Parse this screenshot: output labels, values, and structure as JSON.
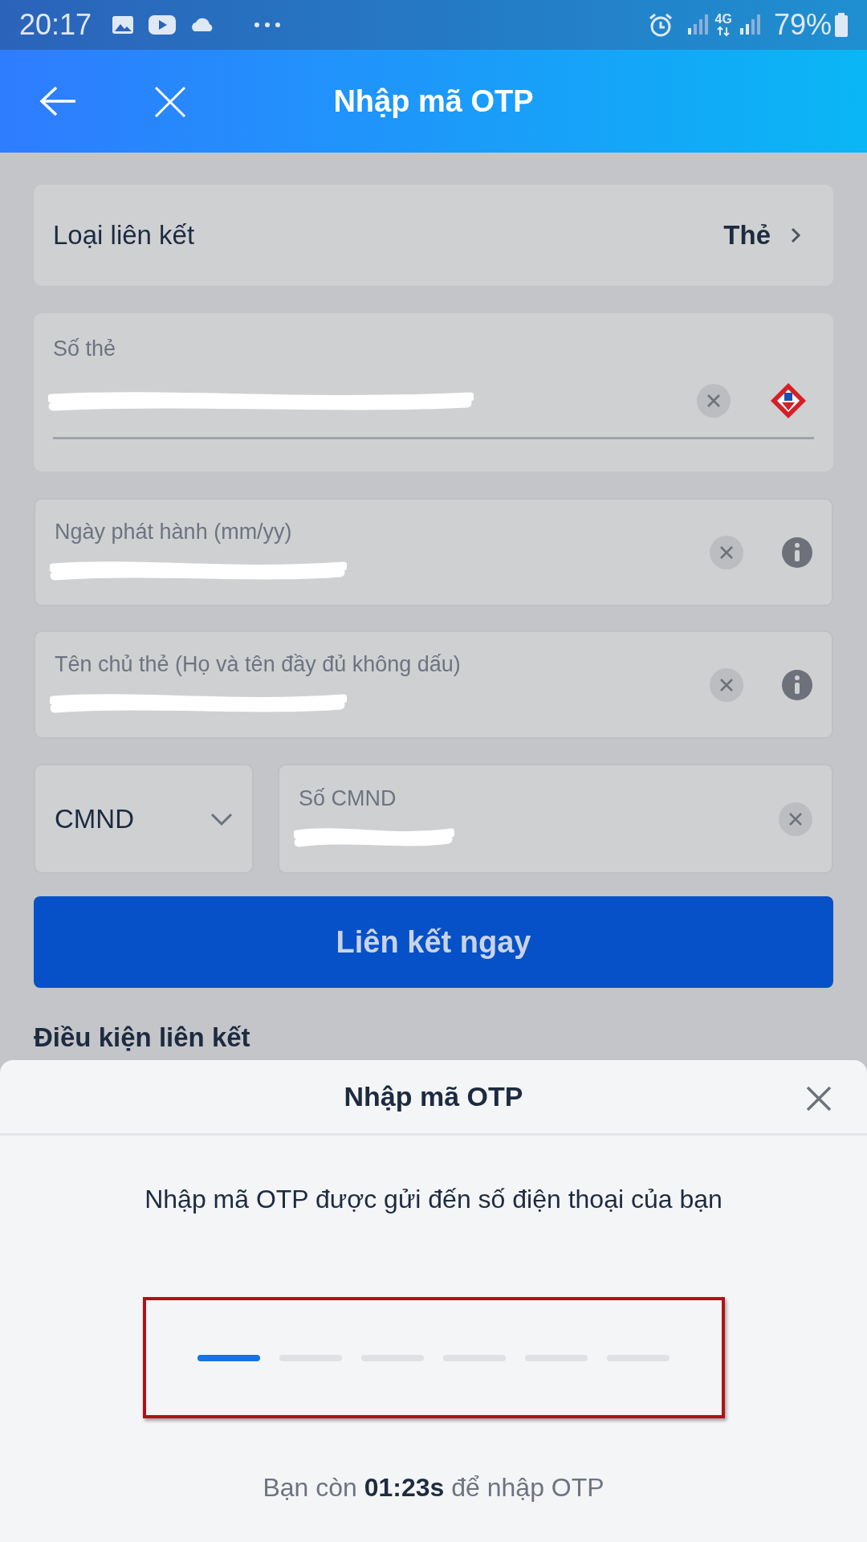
{
  "status_bar": {
    "time": "20:17",
    "network": "4G",
    "battery": "79%"
  },
  "header": {
    "title": "Nhập mã OTP"
  },
  "link_type": {
    "label": "Loại liên kết",
    "value": "Thẻ"
  },
  "fields": [
    {
      "kind": "card",
      "label": "Số thẻ",
      "redacted": true
    },
    {
      "kind": "info",
      "label": "Ngày phát hành (mm/yy)",
      "redacted": true
    },
    {
      "kind": "info",
      "label": "Tên chủ thẻ (Họ và tên đầy đủ không dấu)",
      "redacted": true
    }
  ],
  "id_row": {
    "type": "CMND",
    "field": {
      "label": "Số CMND",
      "redacted": true
    }
  },
  "submit": "Liên kết ngay",
  "section_title": "Điều kiện liên kết",
  "otp_sheet": {
    "title": "Nhập mã OTP",
    "instruction": "Nhập mã OTP được gửi đến số điện thoại của bạn",
    "highlighted": true,
    "slots": [
      {
        "selected": true
      },
      {
        "selected": false
      },
      {
        "selected": false
      },
      {
        "selected": false
      },
      {
        "selected": false
      },
      {
        "selected": false
      }
    ],
    "timer": "Bạn còn **01:23s** để nhập OTP"
  }
}
